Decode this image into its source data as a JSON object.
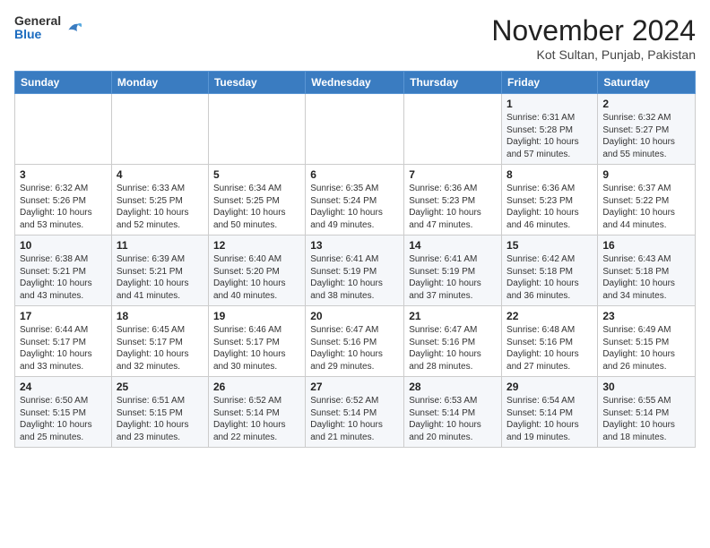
{
  "header": {
    "logo_general": "General",
    "logo_blue": "Blue",
    "title": "November 2024",
    "subtitle": "Kot Sultan, Punjab, Pakistan"
  },
  "calendar": {
    "days_of_week": [
      "Sunday",
      "Monday",
      "Tuesday",
      "Wednesday",
      "Thursday",
      "Friday",
      "Saturday"
    ],
    "weeks": [
      [
        {
          "day": "",
          "info": ""
        },
        {
          "day": "",
          "info": ""
        },
        {
          "day": "",
          "info": ""
        },
        {
          "day": "",
          "info": ""
        },
        {
          "day": "",
          "info": ""
        },
        {
          "day": "1",
          "info": "Sunrise: 6:31 AM\nSunset: 5:28 PM\nDaylight: 10 hours and 57 minutes."
        },
        {
          "day": "2",
          "info": "Sunrise: 6:32 AM\nSunset: 5:27 PM\nDaylight: 10 hours and 55 minutes."
        }
      ],
      [
        {
          "day": "3",
          "info": "Sunrise: 6:32 AM\nSunset: 5:26 PM\nDaylight: 10 hours and 53 minutes."
        },
        {
          "day": "4",
          "info": "Sunrise: 6:33 AM\nSunset: 5:25 PM\nDaylight: 10 hours and 52 minutes."
        },
        {
          "day": "5",
          "info": "Sunrise: 6:34 AM\nSunset: 5:25 PM\nDaylight: 10 hours and 50 minutes."
        },
        {
          "day": "6",
          "info": "Sunrise: 6:35 AM\nSunset: 5:24 PM\nDaylight: 10 hours and 49 minutes."
        },
        {
          "day": "7",
          "info": "Sunrise: 6:36 AM\nSunset: 5:23 PM\nDaylight: 10 hours and 47 minutes."
        },
        {
          "day": "8",
          "info": "Sunrise: 6:36 AM\nSunset: 5:23 PM\nDaylight: 10 hours and 46 minutes."
        },
        {
          "day": "9",
          "info": "Sunrise: 6:37 AM\nSunset: 5:22 PM\nDaylight: 10 hours and 44 minutes."
        }
      ],
      [
        {
          "day": "10",
          "info": "Sunrise: 6:38 AM\nSunset: 5:21 PM\nDaylight: 10 hours and 43 minutes."
        },
        {
          "day": "11",
          "info": "Sunrise: 6:39 AM\nSunset: 5:21 PM\nDaylight: 10 hours and 41 minutes."
        },
        {
          "day": "12",
          "info": "Sunrise: 6:40 AM\nSunset: 5:20 PM\nDaylight: 10 hours and 40 minutes."
        },
        {
          "day": "13",
          "info": "Sunrise: 6:41 AM\nSunset: 5:19 PM\nDaylight: 10 hours and 38 minutes."
        },
        {
          "day": "14",
          "info": "Sunrise: 6:41 AM\nSunset: 5:19 PM\nDaylight: 10 hours and 37 minutes."
        },
        {
          "day": "15",
          "info": "Sunrise: 6:42 AM\nSunset: 5:18 PM\nDaylight: 10 hours and 36 minutes."
        },
        {
          "day": "16",
          "info": "Sunrise: 6:43 AM\nSunset: 5:18 PM\nDaylight: 10 hours and 34 minutes."
        }
      ],
      [
        {
          "day": "17",
          "info": "Sunrise: 6:44 AM\nSunset: 5:17 PM\nDaylight: 10 hours and 33 minutes."
        },
        {
          "day": "18",
          "info": "Sunrise: 6:45 AM\nSunset: 5:17 PM\nDaylight: 10 hours and 32 minutes."
        },
        {
          "day": "19",
          "info": "Sunrise: 6:46 AM\nSunset: 5:17 PM\nDaylight: 10 hours and 30 minutes."
        },
        {
          "day": "20",
          "info": "Sunrise: 6:47 AM\nSunset: 5:16 PM\nDaylight: 10 hours and 29 minutes."
        },
        {
          "day": "21",
          "info": "Sunrise: 6:47 AM\nSunset: 5:16 PM\nDaylight: 10 hours and 28 minutes."
        },
        {
          "day": "22",
          "info": "Sunrise: 6:48 AM\nSunset: 5:16 PM\nDaylight: 10 hours and 27 minutes."
        },
        {
          "day": "23",
          "info": "Sunrise: 6:49 AM\nSunset: 5:15 PM\nDaylight: 10 hours and 26 minutes."
        }
      ],
      [
        {
          "day": "24",
          "info": "Sunrise: 6:50 AM\nSunset: 5:15 PM\nDaylight: 10 hours and 25 minutes."
        },
        {
          "day": "25",
          "info": "Sunrise: 6:51 AM\nSunset: 5:15 PM\nDaylight: 10 hours and 23 minutes."
        },
        {
          "day": "26",
          "info": "Sunrise: 6:52 AM\nSunset: 5:14 PM\nDaylight: 10 hours and 22 minutes."
        },
        {
          "day": "27",
          "info": "Sunrise: 6:52 AM\nSunset: 5:14 PM\nDaylight: 10 hours and 21 minutes."
        },
        {
          "day": "28",
          "info": "Sunrise: 6:53 AM\nSunset: 5:14 PM\nDaylight: 10 hours and 20 minutes."
        },
        {
          "day": "29",
          "info": "Sunrise: 6:54 AM\nSunset: 5:14 PM\nDaylight: 10 hours and 19 minutes."
        },
        {
          "day": "30",
          "info": "Sunrise: 6:55 AM\nSunset: 5:14 PM\nDaylight: 10 hours and 18 minutes."
        }
      ]
    ]
  }
}
